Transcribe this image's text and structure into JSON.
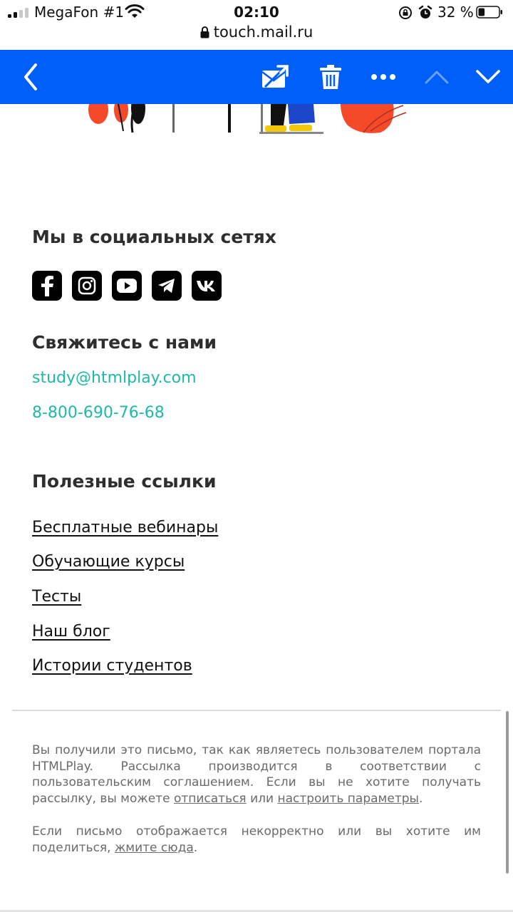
{
  "status_bar": {
    "carrier": "MegaFon #1",
    "time": "02:10",
    "battery_percent": "32 %",
    "battery_level": 0.32,
    "url": "touch.mail.ru"
  },
  "toolbar": {
    "accent": "#005ff9",
    "buttons": [
      "back-icon",
      "move-to-spam-icon",
      "trash-icon",
      "more-icon",
      "previous-icon",
      "next-icon"
    ]
  },
  "social": {
    "title": "Мы в социальных сетях",
    "icons": [
      "facebook-icon",
      "instagram-icon",
      "youtube-icon",
      "telegram-icon",
      "vk-icon"
    ]
  },
  "contacts": {
    "title": "Свяжитесь с нами",
    "email": "study@htmlplay.com",
    "phone": "8-800-690-76-68",
    "color": "#1fb9a6"
  },
  "links": {
    "title": "Полезные ссылки",
    "items": [
      "Бесплатные вебинары",
      "Обучающие курсы",
      "Тесты",
      "Наш блог",
      "Истории студентов"
    ]
  },
  "footer": {
    "p1_text": "Вы получили это письмо, так как являетесь пользователем портала HTMLPlay. Рассылка производится в соответствии с пользовательским соглашением. Если вы не хотите получать рассылку, вы можете ",
    "unsubscribe": "отписаться",
    "or": " или ",
    "settings": "настроить параметры",
    "p1_end": ".",
    "p2_text": "Если письмо отображается некорректно или вы хотите им поделиться, ",
    "click_here": "жмите сюда",
    "p2_end": "."
  }
}
